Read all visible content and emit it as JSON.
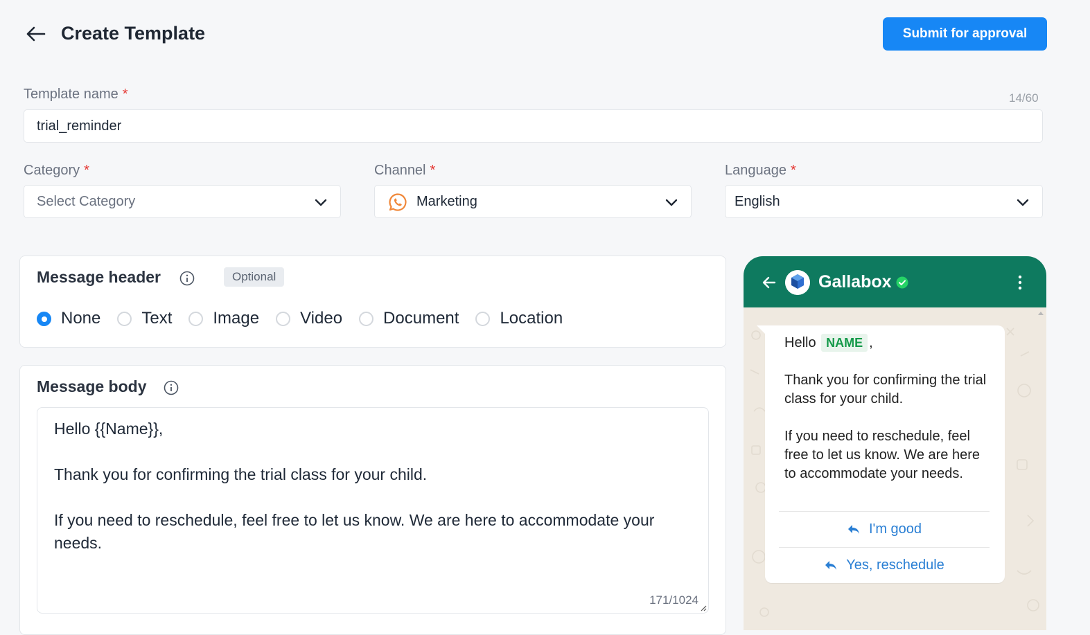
{
  "header": {
    "title": "Create Template",
    "submit_label": "Submit for approval"
  },
  "form": {
    "template_name": {
      "label": "Template name",
      "required_mark": "*",
      "value": "trial_reminder",
      "counter": "14/60"
    },
    "category": {
      "label": "Category",
      "required_mark": "*",
      "placeholder": "Select Category"
    },
    "channel": {
      "label": "Channel",
      "required_mark": "*",
      "value": "Marketing",
      "icon": "whatsapp-icon"
    },
    "language": {
      "label": "Language",
      "required_mark": "*",
      "value": "English"
    }
  },
  "message_header": {
    "title": "Message header",
    "badge": "Optional",
    "options": [
      "None",
      "Text",
      "Image",
      "Video",
      "Document",
      "Location"
    ],
    "selected": "None"
  },
  "message_body": {
    "title": "Message body",
    "text": "Hello {{Name}},\n\nThank you for confirming the trial class for your child.\n\nIf you need to reschedule, feel free to let us know. We are here to accommodate your needs.",
    "counter": "171/1024"
  },
  "preview": {
    "contact_name": "Gallabox",
    "greeting": "Hello",
    "variable_chip": "NAME",
    "greeting_suffix": ",",
    "paragraph1": "Thank you for confirming the trial class for your child.",
    "paragraph2": "If you need to reschedule, feel free to let us know. We are here to accommodate your needs.",
    "buttons": [
      "I'm good",
      "Yes, reschedule"
    ]
  },
  "colors": {
    "primary": "#1787f5",
    "whatsapp_header": "#0e7a5f",
    "required": "#e53935",
    "chip_green": "#159a4a",
    "reply_link": "#2a7fd4"
  }
}
